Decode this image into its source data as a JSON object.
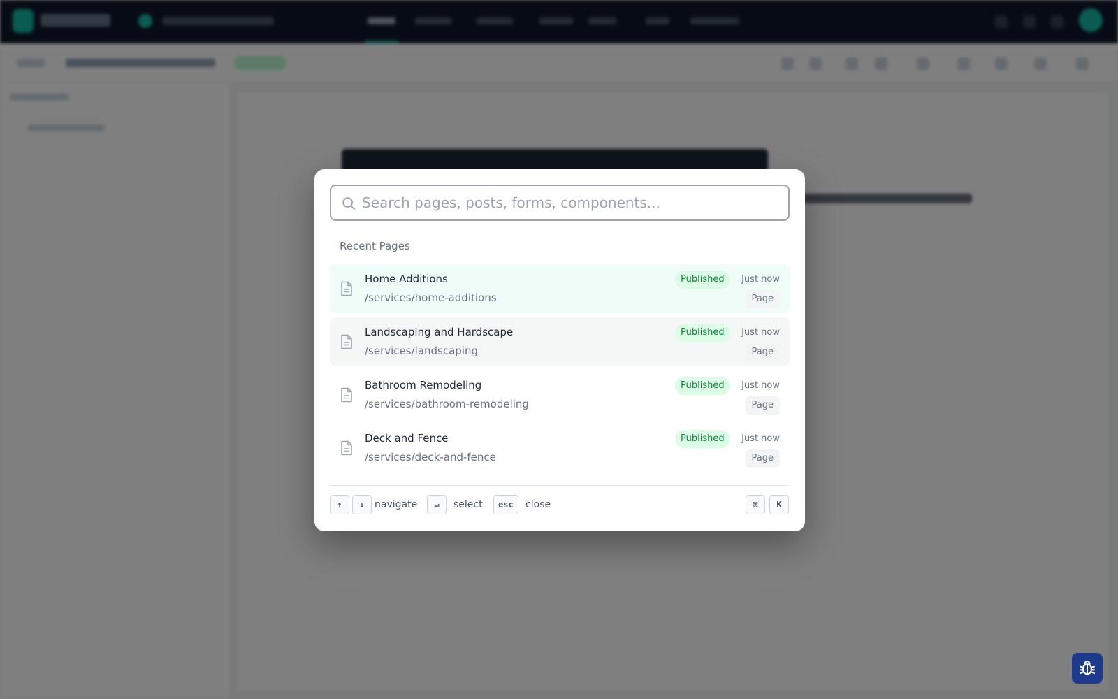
{
  "search": {
    "placeholder": "Search pages, posts, forms, components..."
  },
  "section_label": "Recent Pages",
  "results": [
    {
      "title": "Home Additions",
      "path": "/services/home-additions",
      "status": "Published",
      "time": "Just now",
      "type": "Page"
    },
    {
      "title": "Landscaping and Hardscape",
      "path": "/services/landscaping",
      "status": "Published",
      "time": "Just now",
      "type": "Page"
    },
    {
      "title": "Bathroom Remodeling",
      "path": "/services/bathroom-remodeling",
      "status": "Published",
      "time": "Just now",
      "type": "Page"
    },
    {
      "title": "Deck and Fence",
      "path": "/services/deck-and-fence",
      "status": "Published",
      "time": "Just now",
      "type": "Page"
    }
  ],
  "footer": {
    "up_key": "↑",
    "down_key": "↓",
    "navigate_label": "navigate",
    "enter_key": "↵",
    "select_label": "select",
    "esc_key": "esc",
    "close_label": "close",
    "cmd_key": "⌘",
    "k_key": "K"
  },
  "colors": {
    "accent": "#14b8a6",
    "published_bg": "#dcfce7",
    "published_text": "#15803d",
    "highlight_row": "#effcf8",
    "bug_button": "#1e3a8a"
  },
  "icons": {
    "search": "search-icon",
    "document": "document-icon",
    "bug": "bug-icon"
  }
}
